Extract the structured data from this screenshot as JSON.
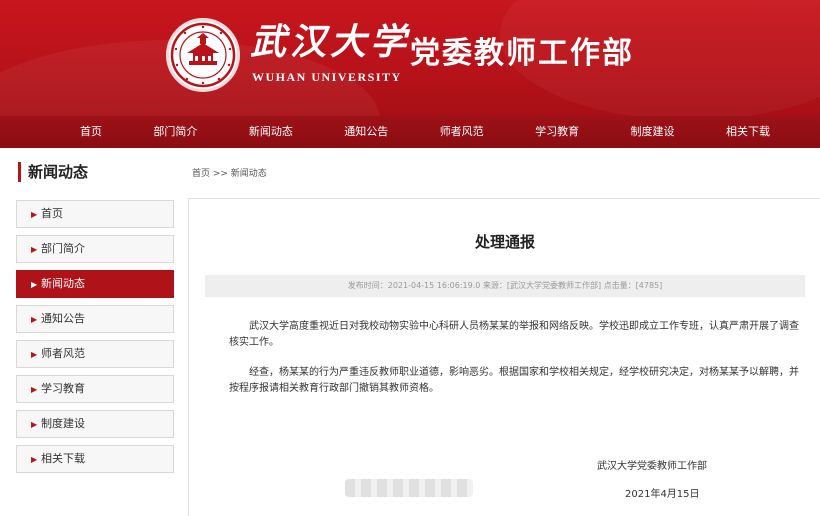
{
  "header": {
    "logo_cn": "武汉大学",
    "logo_en": "WUHAN UNIVERSITY",
    "dept_title": "党委教师工作部"
  },
  "nav": {
    "items": [
      "首页",
      "部门简介",
      "新闻动态",
      "通知公告",
      "师者风范",
      "学习教育",
      "制度建设",
      "相关下载"
    ]
  },
  "sidebar": {
    "title": "新闻动态",
    "items": [
      {
        "label": "首页"
      },
      {
        "label": "部门简介"
      },
      {
        "label": "新闻动态"
      },
      {
        "label": "通知公告"
      },
      {
        "label": "师者风范"
      },
      {
        "label": "学习教育"
      },
      {
        "label": "制度建设"
      },
      {
        "label": "相关下载"
      }
    ],
    "active_index": 2
  },
  "breadcrumb": "首页 >> 新闻动态",
  "article": {
    "title": "处理通报",
    "meta": "发布时间：2021-04-15 16:06:19.0 来源：[武汉大学党委教师工作部] 点击量：[4785]",
    "paragraphs": [
      "武汉大学高度重视近日对我校动物实验中心科研人员杨某某的举报和网络反映。学校迅即成立工作专班，认真严肃开展了调查核实工作。",
      "经查，杨某某的行为严重违反教师职业道德，影响恶劣。根据国家和学校相关规定，经学校研究决定，对杨某某予以解聘，并按程序报请相关教育行政部门撤销其教师资格。"
    ],
    "signature": "武汉大学党委教师工作部",
    "date": "2021年4月15日"
  },
  "colors": {
    "brand_red": "#b8121a",
    "nav_red": "#8a0d13",
    "active_item": "#b01219"
  }
}
